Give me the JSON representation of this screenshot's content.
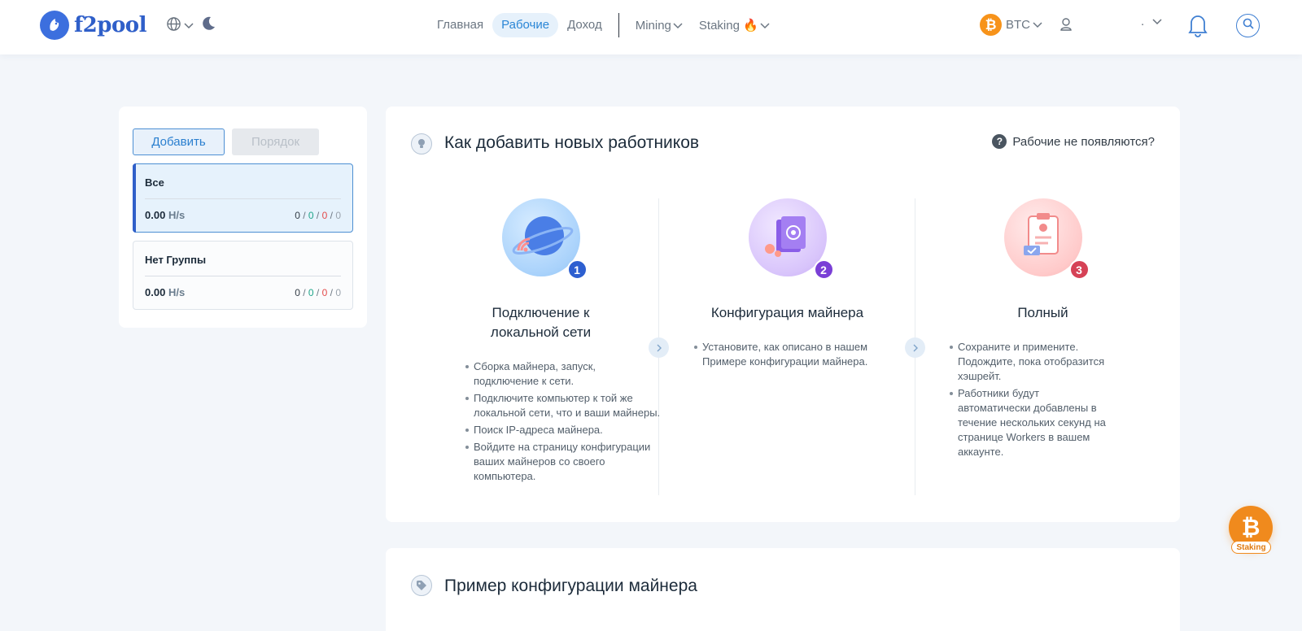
{
  "header": {
    "logo_text": "f2pool",
    "nav": [
      {
        "label": "Главная"
      },
      {
        "label": "Рабочие",
        "active": true
      },
      {
        "label": "Доход"
      }
    ],
    "mining_label": "Mining",
    "staking_label": "Staking 🔥",
    "coin": {
      "symbol": "₿",
      "label": "BTC"
    },
    "account_label": "."
  },
  "sidebar": {
    "add_label": "Добавить",
    "order_label": "Порядок",
    "groups": [
      {
        "name": "Все",
        "hashrate": "0.00",
        "unit": "H/s",
        "total": "0",
        "active_count": "0",
        "inactive_count": "0",
        "dead_count": "0"
      },
      {
        "name": "Нет Группы",
        "hashrate": "0.00",
        "unit": "H/s",
        "total": "0",
        "active_count": "0",
        "inactive_count": "0",
        "dead_count": "0"
      }
    ]
  },
  "main": {
    "title": "Как добавить новых работников",
    "help_link": "Рабочие не появляются?",
    "steps": [
      {
        "number": "1",
        "title": "Подключение к локальной сети",
        "items": [
          "Сборка майнера, запуск, подключение к сети.",
          "Подключите компьютер к той же локальной сети, что и ваши майнеры.",
          "Поиск IP-адреса майнера.",
          "Войдите на страницу конфигурации ваших майнеров со своего компьютера."
        ]
      },
      {
        "number": "2",
        "title": "Конфигурация майнера",
        "items": [
          "Установите, как описано в нашем Примере конфигурации майнера."
        ]
      },
      {
        "number": "3",
        "title": "Полный",
        "items": [
          "Сохраните и примените. Подождите, пока отобразится хэшрейт.",
          "Работники будут автоматически добавлены в течение нескольких секунд на странице Workers в вашем аккаунте."
        ]
      }
    ]
  },
  "example": {
    "title": "Пример конфигурации майнера"
  },
  "staking_float": {
    "symbol": "₿",
    "label": "Staking"
  },
  "colors": {
    "accent": "#2a86d6",
    "brand": "#2f5fc9",
    "bitcoin": "#f7931a",
    "active": "#1fa58a",
    "dead": "#e44b4b"
  }
}
